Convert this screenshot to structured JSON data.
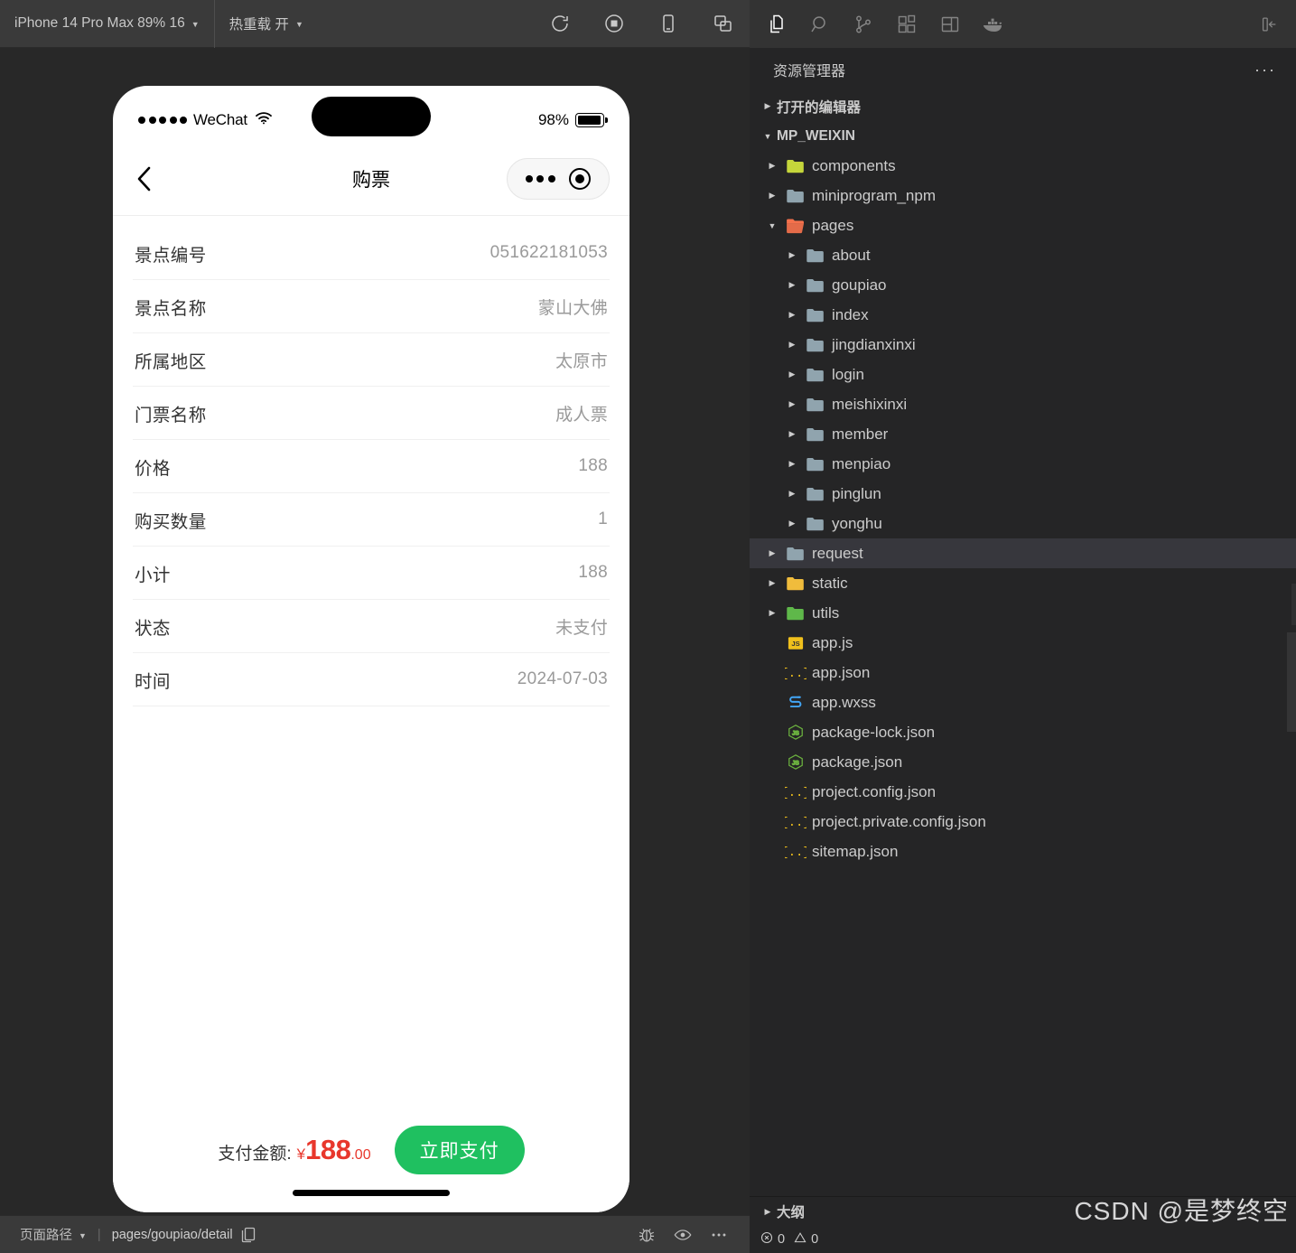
{
  "simulator": {
    "toolbar": {
      "device_selector": "iPhone 14 Pro Max 89% 16",
      "hot_reload": "热重载 开",
      "icons": [
        {
          "name": "refresh-icon",
          "label": "刷新"
        },
        {
          "name": "record-stop-icon",
          "label": "停止"
        },
        {
          "name": "device-icon",
          "label": "设备"
        },
        {
          "name": "windows-icon",
          "label": "多窗口"
        }
      ]
    },
    "phone": {
      "status_bar": {
        "carrier": "WeChat",
        "battery_percent": "98%"
      },
      "nav": {
        "title": "购票",
        "back_icon": "chevron-left-icon"
      },
      "detail_rows": [
        {
          "label": "景点编号",
          "value": "051622181053"
        },
        {
          "label": "景点名称",
          "value": "蒙山大佛"
        },
        {
          "label": "所属地区",
          "value": "太原市"
        },
        {
          "label": "门票名称",
          "value": "成人票"
        },
        {
          "label": "价格",
          "value": "188"
        },
        {
          "label": "购买数量",
          "value": "1"
        },
        {
          "label": "小计",
          "value": "188"
        },
        {
          "label": "状态",
          "value": "未支付"
        },
        {
          "label": "时间",
          "value": "2024-07-03"
        }
      ],
      "pay": {
        "label": "支付金额:",
        "currency": "¥",
        "amount": "188",
        "cents": ".00",
        "button": "立即支付",
        "button_color": "#1fc060",
        "amount_color": "#e8372c"
      }
    },
    "status_bar": {
      "page_path_label": "页面路径",
      "divider": "|",
      "page_path": "pages/goupiao/detail",
      "copy_icon": "copy-icon",
      "icons": [
        {
          "name": "bug-icon"
        },
        {
          "name": "eye-icon"
        },
        {
          "name": "more-icon"
        }
      ]
    }
  },
  "vscode": {
    "activity_bar": [
      {
        "name": "explorer-icon",
        "label": "资源管理器",
        "active": true
      },
      {
        "name": "search-icon",
        "label": "搜索",
        "active": false
      },
      {
        "name": "source-control-icon",
        "label": "源代码管理",
        "active": false
      },
      {
        "name": "extensions-icon",
        "label": "扩展",
        "active": false
      },
      {
        "name": "layout-panel-icon",
        "label": "布局",
        "active": false
      },
      {
        "name": "docker-icon",
        "label": "Docker",
        "active": false
      }
    ],
    "collapse_icon": "collapse-sidebar-icon",
    "panel_title": "资源管理器",
    "panel_more": "···",
    "sections": [
      {
        "label": "打开的编辑器",
        "expanded": false
      },
      {
        "label": "MP_WEIXIN",
        "expanded": true
      }
    ],
    "tree": [
      {
        "label": "components",
        "type": "folder",
        "indent": 1,
        "expanded": false,
        "icon": "folder-components-icon",
        "color": "#c5d63b",
        "selected": false
      },
      {
        "label": "miniprogram_npm",
        "type": "folder",
        "indent": 1,
        "expanded": false,
        "icon": "folder-icon",
        "color": "#90a4ae",
        "selected": false
      },
      {
        "label": "pages",
        "type": "folder",
        "indent": 1,
        "expanded": true,
        "icon": "folder-pages-icon",
        "color": "#f4714c",
        "selected": false
      },
      {
        "label": "about",
        "type": "folder",
        "indent": 2,
        "expanded": false,
        "icon": "folder-icon",
        "color": "#90a4ae",
        "selected": false
      },
      {
        "label": "goupiao",
        "type": "folder",
        "indent": 2,
        "expanded": false,
        "icon": "folder-icon",
        "color": "#90a4ae",
        "selected": false
      },
      {
        "label": "index",
        "type": "folder",
        "indent": 2,
        "expanded": false,
        "icon": "folder-icon",
        "color": "#90a4ae",
        "selected": false
      },
      {
        "label": "jingdianxinxi",
        "type": "folder",
        "indent": 2,
        "expanded": false,
        "icon": "folder-icon",
        "color": "#90a4ae",
        "selected": false
      },
      {
        "label": "login",
        "type": "folder",
        "indent": 2,
        "expanded": false,
        "icon": "folder-icon",
        "color": "#90a4ae",
        "selected": false
      },
      {
        "label": "meishixinxi",
        "type": "folder",
        "indent": 2,
        "expanded": false,
        "icon": "folder-icon",
        "color": "#90a4ae",
        "selected": false
      },
      {
        "label": "member",
        "type": "folder",
        "indent": 2,
        "expanded": false,
        "icon": "folder-icon",
        "color": "#90a4ae",
        "selected": false
      },
      {
        "label": "menpiao",
        "type": "folder",
        "indent": 2,
        "expanded": false,
        "icon": "folder-icon",
        "color": "#90a4ae",
        "selected": false
      },
      {
        "label": "pinglun",
        "type": "folder",
        "indent": 2,
        "expanded": false,
        "icon": "folder-icon",
        "color": "#90a4ae",
        "selected": false
      },
      {
        "label": "yonghu",
        "type": "folder",
        "indent": 2,
        "expanded": false,
        "icon": "folder-icon",
        "color": "#90a4ae",
        "selected": false
      },
      {
        "label": "request",
        "type": "folder",
        "indent": 1,
        "expanded": false,
        "icon": "folder-icon",
        "color": "#90a4ae",
        "selected": true
      },
      {
        "label": "static",
        "type": "folder",
        "indent": 1,
        "expanded": false,
        "icon": "folder-static-icon",
        "color": "#f0bc3c",
        "selected": false
      },
      {
        "label": "utils",
        "type": "folder",
        "indent": 1,
        "expanded": false,
        "icon": "folder-utils-icon",
        "color": "#5fb84a",
        "selected": false
      },
      {
        "label": "app.js",
        "type": "file",
        "indent": 1,
        "icon": "js-file-icon",
        "color": "#f0c01c",
        "selected": false
      },
      {
        "label": "app.json",
        "type": "file",
        "indent": 1,
        "icon": "json-file-icon",
        "color": "#f0c01c",
        "selected": false
      },
      {
        "label": "app.wxss",
        "type": "file",
        "indent": 1,
        "icon": "css-file-icon",
        "color": "#42a5f5",
        "selected": false
      },
      {
        "label": "package-lock.json",
        "type": "file",
        "indent": 1,
        "icon": "node-file-icon",
        "color": "#6cb33f",
        "selected": false
      },
      {
        "label": "package.json",
        "type": "file",
        "indent": 1,
        "icon": "node-file-icon",
        "color": "#6cb33f",
        "selected": false
      },
      {
        "label": "project.config.json",
        "type": "file",
        "indent": 1,
        "icon": "json-file-icon",
        "color": "#f0c01c",
        "selected": false
      },
      {
        "label": "project.private.config.json",
        "type": "file",
        "indent": 1,
        "icon": "json-file-icon",
        "color": "#f0c01c",
        "selected": false
      },
      {
        "label": "sitemap.json",
        "type": "file",
        "indent": 1,
        "icon": "json-file-icon",
        "color": "#f0c01c",
        "selected": false
      }
    ],
    "outline_label": "大纲",
    "status": {
      "errors": "0",
      "warnings": "0"
    }
  },
  "watermark": "CSDN @是梦终空"
}
